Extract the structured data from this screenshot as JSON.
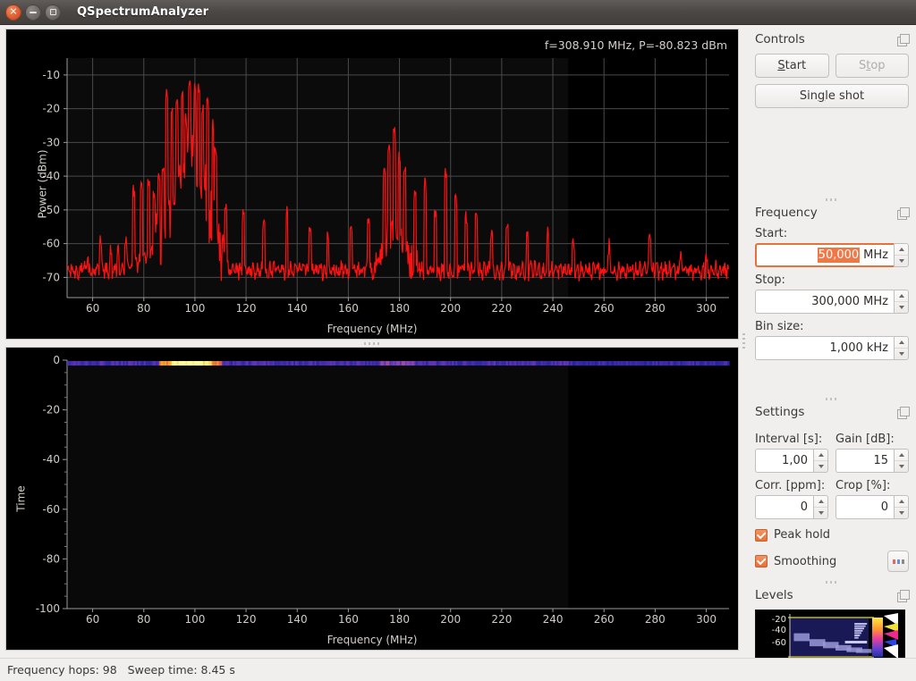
{
  "window": {
    "title": "QSpectrumAnalyzer",
    "buttons": {
      "close": "×",
      "minimize": "−",
      "maximize": "□"
    }
  },
  "spectrum": {
    "readout": "f=308.910 MHz, P=-80.823 dBm",
    "xlabel": "Frequency (MHz)",
    "ylabel": "Power (dBm)"
  },
  "waterfall": {
    "xlabel": "Frequency (MHz)",
    "ylabel": "Time"
  },
  "panel": {
    "controls": {
      "title": "Controls",
      "start_label": "Start",
      "start_mnemonic": "S",
      "stop_label": "Stop",
      "stop_mnemonic": "t",
      "single_label": "Single shot",
      "single_mnemonic": "g"
    },
    "frequency": {
      "title": "Frequency",
      "start_label": "Start:",
      "start_value": "50,000",
      "start_unit": "MHz",
      "start_selected": true,
      "stop_label": "Stop:",
      "stop_value": "300,000 MHz",
      "bin_label": "Bin size:",
      "bin_value": "1,000 kHz"
    },
    "settings": {
      "title": "Settings",
      "interval_label": "Interval [s]:",
      "interval_value": "1,00",
      "gain_label": "Gain [dB]:",
      "gain_value": "15",
      "corr_label": "Corr. [ppm]:",
      "corr_value": "0",
      "crop_label": "Crop [%]:",
      "crop_value": "0",
      "peak_hold_label": "Peak hold",
      "peak_hold_checked": true,
      "smoothing_label": "Smoothing",
      "smoothing_checked": true,
      "more_label": "..."
    },
    "levels": {
      "title": "Levels"
    },
    "dock_icon": "float-dock-icon"
  },
  "statusbar": {
    "hops_label": "Frequency hops: 98",
    "sweep_label": "Sweep time: 8.45 s"
  },
  "colors": {
    "trace": "#ff1111",
    "accent": "#e8703a",
    "plot_bg": "#000000",
    "grid": "#4a4a4a",
    "axis_text": "#cfcbc5",
    "panel_bg": "#f0efee",
    "titlebar": "#4b4745"
  },
  "chart_data": [
    {
      "type": "line",
      "name": "spectrum",
      "title": "",
      "xlabel": "Frequency (MHz)",
      "ylabel": "Power (dBm)",
      "xlim": [
        50,
        308.91
      ],
      "ylim": [
        -76,
        -5
      ],
      "xticks": [
        60,
        80,
        100,
        120,
        140,
        160,
        180,
        200,
        220,
        240,
        260,
        280,
        300
      ],
      "yticks": [
        -10,
        -20,
        -30,
        -40,
        -50,
        -60,
        -70
      ],
      "grid": true,
      "series": [
        {
          "name": "Power",
          "color": "#ff1111",
          "noise_floor_dbm": -68,
          "noise_amplitude_db": 4,
          "features": [
            {
              "f": 58,
              "peak": -64
            },
            {
              "f": 63,
              "peak": -57
            },
            {
              "f": 67,
              "peak": -62
            },
            {
              "f": 70,
              "peak": -61
            },
            {
              "f": 73,
              "peak": -58
            },
            {
              "f": 76,
              "peak": -44
            },
            {
              "f": 79,
              "peak": -41
            },
            {
              "f": 82,
              "peak": -40
            },
            {
              "f": 84,
              "peak": -44
            },
            {
              "f": 86,
              "peak": -39
            },
            {
              "f": 87.5,
              "peak": -36
            },
            {
              "f": 89,
              "peak": -14
            },
            {
              "f": 91,
              "peak": -20
            },
            {
              "f": 93,
              "peak": -18
            },
            {
              "f": 95,
              "peak": -15
            },
            {
              "f": 96.5,
              "peak": -22
            },
            {
              "f": 98,
              "peak": -10
            },
            {
              "f": 100,
              "peak": -14
            },
            {
              "f": 101.5,
              "peak": -13
            },
            {
              "f": 103,
              "peak": -19
            },
            {
              "f": 105,
              "peak": -17
            },
            {
              "f": 107,
              "peak": -24
            },
            {
              "f": 108,
              "peak": -30
            },
            {
              "f": 112,
              "peak": -48
            },
            {
              "f": 119,
              "peak": -50
            },
            {
              "f": 127,
              "peak": -53
            },
            {
              "f": 136,
              "peak": -49
            },
            {
              "f": 145,
              "peak": -55
            },
            {
              "f": 152,
              "peak": -57
            },
            {
              "f": 161,
              "peak": -54
            },
            {
              "f": 168,
              "peak": -52
            },
            {
              "f": 174,
              "peak": -37
            },
            {
              "f": 176,
              "peak": -31
            },
            {
              "f": 178,
              "peak": -26
            },
            {
              "f": 180,
              "peak": -33
            },
            {
              "f": 182,
              "peak": -36
            },
            {
              "f": 186,
              "peak": -44
            },
            {
              "f": 190,
              "peak": -42
            },
            {
              "f": 194,
              "peak": -50
            },
            {
              "f": 198,
              "peak": -38
            },
            {
              "f": 202,
              "peak": -46
            },
            {
              "f": 206,
              "peak": -52
            },
            {
              "f": 210,
              "peak": -50
            },
            {
              "f": 216,
              "peak": -56
            },
            {
              "f": 222,
              "peak": -53
            },
            {
              "f": 230,
              "peak": -57
            },
            {
              "f": 238,
              "peak": -55
            },
            {
              "f": 248,
              "peak": -58
            },
            {
              "f": 262,
              "peak": -60
            },
            {
              "f": 278,
              "peak": -57
            },
            {
              "f": 290,
              "peak": -62
            },
            {
              "f": 300,
              "peak": -63
            }
          ]
        }
      ]
    },
    {
      "type": "heatmap",
      "name": "waterfall",
      "title": "",
      "xlabel": "Frequency (MHz)",
      "ylabel": "Time",
      "xlim": [
        50,
        308.91
      ],
      "ylim": [
        -100,
        0
      ],
      "xticks": [
        60,
        80,
        100,
        120,
        140,
        160,
        180,
        200,
        220,
        240,
        260,
        280,
        300
      ],
      "yticks": [
        0,
        -20,
        -40,
        -60,
        -80,
        -100
      ],
      "rows_filled": 1,
      "colormap": [
        "#000033",
        "#2020a0",
        "#8040c0",
        "#e06040",
        "#ffc020",
        "#ffffa0"
      ],
      "note": "Single row of sweep data at Time=0; hot (orange/yellow) in 88-108 MHz FM band, blue elsewhere"
    }
  ]
}
